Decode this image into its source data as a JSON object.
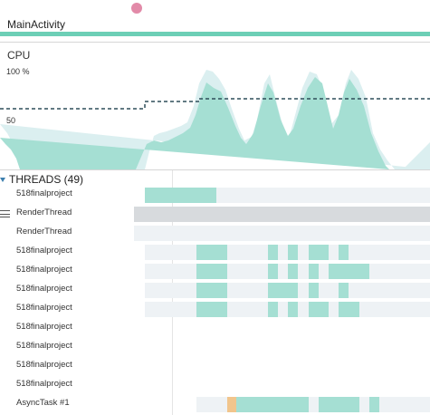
{
  "header": {
    "activity": "MainActivity",
    "colors": {
      "activity_bar": "#6ccfb6",
      "session_dot": "#e28aa8"
    }
  },
  "cpu": {
    "label": "CPU",
    "axis_top": "100 %",
    "axis_mid": "50",
    "colors": {
      "fill": "#a5dfd3",
      "fill_light": "#dbeff0",
      "threshold_line": "#2f4f5a"
    }
  },
  "threads": {
    "title": "THREADS (49)",
    "expand_icon": "triangle-down-icon",
    "colors": {
      "running": "#a5dfd3",
      "idle": "#eef2f5",
      "selected": "#d7dadd",
      "highlight": "#f1c58c"
    },
    "rows": [
      {
        "label": "518finalproject",
        "state": "normal",
        "track": [
          0.337,
          1.0
        ],
        "segments": [
          [
            0.337,
            0.503,
            "running"
          ]
        ]
      },
      {
        "label": "RenderThread",
        "state": "selected",
        "track": [
          0.312,
          1.0
        ],
        "segments": []
      },
      {
        "label": "RenderThread",
        "state": "normal",
        "track": [
          0.312,
          1.0
        ],
        "segments": []
      },
      {
        "label": "518finalproject",
        "state": "normal",
        "track": [
          0.337,
          1.0
        ],
        "segments": [
          [
            0.457,
            0.528,
            "running"
          ],
          [
            0.623,
            0.647,
            "running"
          ],
          [
            0.669,
            0.693,
            "running"
          ],
          [
            0.717,
            0.764,
            "running"
          ],
          [
            0.787,
            0.811,
            "running"
          ]
        ]
      },
      {
        "label": "518finalproject",
        "state": "normal",
        "track": [
          0.337,
          1.0
        ],
        "segments": [
          [
            0.457,
            0.528,
            "running"
          ],
          [
            0.623,
            0.647,
            "running"
          ],
          [
            0.669,
            0.693,
            "running"
          ],
          [
            0.717,
            0.741,
            "running"
          ],
          [
            0.764,
            0.859,
            "running"
          ]
        ]
      },
      {
        "label": "518finalproject",
        "state": "normal",
        "track": [
          0.337,
          1.0
        ],
        "segments": [
          [
            0.457,
            0.528,
            "running"
          ],
          [
            0.623,
            0.693,
            "running"
          ],
          [
            0.717,
            0.741,
            "running"
          ],
          [
            0.787,
            0.811,
            "running"
          ]
        ]
      },
      {
        "label": "518finalproject",
        "state": "normal",
        "track": [
          0.337,
          1.0
        ],
        "segments": [
          [
            0.457,
            0.528,
            "running"
          ],
          [
            0.623,
            0.647,
            "running"
          ],
          [
            0.669,
            0.693,
            "running"
          ],
          [
            0.717,
            0.764,
            "running"
          ],
          [
            0.787,
            0.836,
            "running"
          ]
        ]
      },
      {
        "label": "518finalproject",
        "state": "normal",
        "track": null,
        "segments": []
      },
      {
        "label": "518finalproject",
        "state": "normal",
        "track": null,
        "segments": []
      },
      {
        "label": "518finalproject",
        "state": "normal",
        "track": null,
        "segments": []
      },
      {
        "label": "518finalproject",
        "state": "normal",
        "track": null,
        "segments": []
      },
      {
        "label": "AsyncTask #1",
        "state": "normal",
        "track": [
          0.457,
          1.0
        ],
        "segments": [
          [
            0.528,
            0.549,
            "highlight"
          ],
          [
            0.549,
            0.717,
            "running"
          ],
          [
            0.741,
            0.836,
            "running"
          ],
          [
            0.859,
            0.882,
            "running"
          ]
        ]
      }
    ]
  }
}
